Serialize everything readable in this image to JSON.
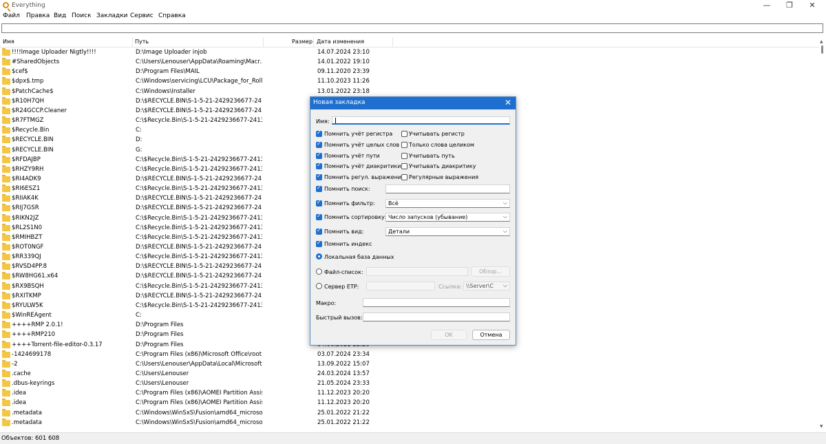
{
  "window": {
    "title": "Everything",
    "minimize": "—",
    "maximize": "❐",
    "close": "✕"
  },
  "menu": [
    "Файл",
    "Правка",
    "Вид",
    "Поиск",
    "Закладки",
    "Сервис",
    "Справка"
  ],
  "search": {
    "value": ""
  },
  "columns": {
    "name": "Имя",
    "path": "Путь",
    "size": "Размер",
    "modified": "Дата изменения"
  },
  "rows": [
    {
      "name": "!!!!Image Uploader Nigtly!!!!",
      "path": "D:\\Image Uploader injob",
      "date": "14.07.2024 23:10"
    },
    {
      "name": "#SharedObjects",
      "path": "C:\\Users\\Lenouser\\AppData\\Roaming\\Macr...",
      "date": "14.01.2022 19:10"
    },
    {
      "name": "$cef$",
      "path": "D:\\Program Files\\MAIL",
      "date": "09.11.2020 23:39"
    },
    {
      "name": "$dpx$.tmp",
      "path": "C:\\Windows\\servicing\\LCU\\Package_for_Roll...",
      "date": "11.10.2023 11:26"
    },
    {
      "name": "$PatchCache$",
      "path": "C:\\Windows\\Installer",
      "date": "13.01.2022 23:18"
    },
    {
      "name": "$R10H7QH",
      "path": "D:\\$RECYCLE.BIN\\S-1-5-21-2429236677-2413...",
      "date": ""
    },
    {
      "name": "$R24GCCP.Cleaner",
      "path": "D:\\$RECYCLE.BIN\\S-1-5-21-2429236677-2413...",
      "date": ""
    },
    {
      "name": "$R7FTMGZ",
      "path": "C:\\$Recycle.Bin\\S-1-5-21-2429236677-241326...",
      "date": ""
    },
    {
      "name": "$Recycle.Bin",
      "path": "C:",
      "date": ""
    },
    {
      "name": "$RECYCLE.BIN",
      "path": "D:",
      "date": ""
    },
    {
      "name": "$RECYCLE.BIN",
      "path": "G:",
      "date": ""
    },
    {
      "name": "$RFDAJBP",
      "path": "C:\\$Recycle.Bin\\S-1-5-21-2429236677-241326...",
      "date": ""
    },
    {
      "name": "$RHZY9RH",
      "path": "C:\\$Recycle.Bin\\S-1-5-21-2429236677-241326...",
      "date": ""
    },
    {
      "name": "$RI4ADK9",
      "path": "D:\\$RECYCLE.BIN\\S-1-5-21-2429236677-2413...",
      "date": ""
    },
    {
      "name": "$RI6ESZ1",
      "path": "C:\\$Recycle.Bin\\S-1-5-21-2429236677-241326...",
      "date": ""
    },
    {
      "name": "$RIIAK4K",
      "path": "D:\\$RECYCLE.BIN\\S-1-5-21-2429236677-2413...",
      "date": ""
    },
    {
      "name": "$RIJ7GSR",
      "path": "D:\\$RECYCLE.BIN\\S-1-5-21-2429236677-2413...",
      "date": ""
    },
    {
      "name": "$RIKN2JZ",
      "path": "C:\\$Recycle.Bin\\S-1-5-21-2429236677-241326...",
      "date": ""
    },
    {
      "name": "$RL2S1N0",
      "path": "C:\\$Recycle.Bin\\S-1-5-21-2429236677-241326...",
      "date": ""
    },
    {
      "name": "$RMIHBZT",
      "path": "C:\\$Recycle.Bin\\S-1-5-21-2429236677-241326...",
      "date": ""
    },
    {
      "name": "$ROT0NGF",
      "path": "D:\\$RECYCLE.BIN\\S-1-5-21-2429236677-2413...",
      "date": ""
    },
    {
      "name": "$RR339QJ",
      "path": "C:\\$Recycle.Bin\\S-1-5-21-2429236677-241326...",
      "date": ""
    },
    {
      "name": "$RVSD4PP.8",
      "path": "D:\\$RECYCLE.BIN\\S-1-5-21-2429236677-2413...",
      "date": ""
    },
    {
      "name": "$RW8HG61.x64",
      "path": "D:\\$RECYCLE.BIN\\S-1-5-21-2429236677-2413...",
      "date": ""
    },
    {
      "name": "$RX9BSQH",
      "path": "C:\\$Recycle.Bin\\S-1-5-21-2429236677-241326...",
      "date": ""
    },
    {
      "name": "$RXITKMP",
      "path": "D:\\$RECYCLE.BIN\\S-1-5-21-2429236677-2413...",
      "date": ""
    },
    {
      "name": "$RYULW5K",
      "path": "C:\\$Recycle.Bin\\S-1-5-21-2429236677-241326...",
      "date": ""
    },
    {
      "name": "$WinREAgent",
      "path": "C:",
      "date": ""
    },
    {
      "name": "++++RMP 2.0.1!",
      "path": "D:\\Program Files",
      "date": ""
    },
    {
      "name": "++++RMP210",
      "path": "D:\\Program Files",
      "date": ""
    },
    {
      "name": "++++Torrent-file-editor-0.3.17",
      "path": "D:\\Program Files",
      "date": "04.06.2021 22:20"
    },
    {
      "name": "-1424699178",
      "path": "C:\\Program Files (x86)\\Microsoft Office\\root...",
      "date": "03.07.2024 23:34"
    },
    {
      "name": "-2",
      "path": "C:\\Users\\Lenouser\\AppData\\Local\\Microsoft...",
      "date": "13.09.2022 15:07"
    },
    {
      "name": ".cache",
      "path": "C:\\Users\\Lenouser",
      "date": "24.03.2024 13:57"
    },
    {
      "name": ".dbus-keyrings",
      "path": "C:\\Users\\Lenouser",
      "date": "21.05.2024 23:33"
    },
    {
      "name": ".idea",
      "path": "C:\\Program Files (x86)\\AOMEI Partition Assis...",
      "date": "11.12.2023 20:20"
    },
    {
      "name": ".idea",
      "path": "C:\\Program Files (x86)\\AOMEI Partition Assis...",
      "date": "11.12.2023 20:20"
    },
    {
      "name": ".metadata",
      "path": "C:\\Windows\\WinSxS\\Fusion\\amd64_microso...",
      "date": "25.01.2022 21:22"
    },
    {
      "name": ".metadata",
      "path": "C:\\Windows\\WinSxS\\Fusion\\amd64_microso...",
      "date": "25.01.2022 21:22"
    }
  ],
  "status": {
    "text": "Объектов: 601 608"
  },
  "dialog": {
    "title": "Новая закладка",
    "close": "✕",
    "name_label": "Имя:",
    "name_value": "",
    "left_checks": [
      {
        "label": "Помнить учёт регистра",
        "checked": true
      },
      {
        "label": "Помнить учёт целых слов",
        "checked": true
      },
      {
        "label": "Помнить учёт пути",
        "checked": true
      },
      {
        "label": "Помнить учёт диакритики",
        "checked": true
      },
      {
        "label": "Помнить регул. выражения",
        "checked": true
      }
    ],
    "right_checks": [
      {
        "label": "Учитывать регистр",
        "checked": false
      },
      {
        "label": "Только слова целиком",
        "checked": false
      },
      {
        "label": "Учитывать путь",
        "checked": false
      },
      {
        "label": "Учитывать диакритику",
        "checked": false
      },
      {
        "label": "Регулярные выражения",
        "checked": false
      }
    ],
    "remember_search": "Помнить поиск:",
    "search_value": "",
    "remember_filter": "Помнить фильтр:",
    "filter_value": "Всё",
    "remember_sort": "Помнить сортировку:",
    "sort_value": "Число запусков (убывание)",
    "remember_view": "Помнить вид:",
    "view_value": "Детали",
    "remember_index": "Помнить индекс",
    "local_db": "Локальная база данных",
    "file_list": "Файл-список:",
    "browse": "Обзор...",
    "ftp_server": "Сервер ETP:",
    "link_label": "Ссылка:",
    "link_value": "\\\\Server\\C",
    "macro_label": "Макро:",
    "hotkey_label": "Быстрый вызов:",
    "ok": "OK",
    "cancel": "Отмена"
  }
}
